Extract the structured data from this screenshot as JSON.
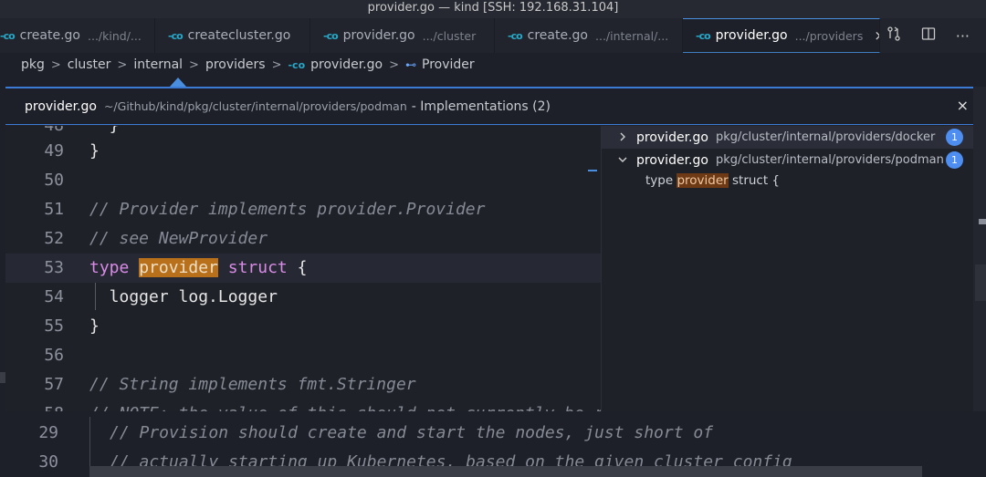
{
  "window": {
    "title": "provider.go — kind [SSH: 192.168.31.104]"
  },
  "tabs": [
    {
      "label": "create.go",
      "dir": ".../kind/..."
    },
    {
      "label": "createcluster.go",
      "dir": ""
    },
    {
      "label": "provider.go",
      "dir": ".../cluster"
    },
    {
      "label": "create.go",
      "dir": ".../internal/..."
    },
    {
      "label": "provider.go",
      "dir": ".../providers",
      "active": true
    }
  ],
  "tab_icon_text": "-co",
  "tab_actions": {
    "compare_icon": "git-compare-icon",
    "split_icon": "split-editor-icon",
    "more_label": "···"
  },
  "breadcrumb": {
    "items": [
      "pkg",
      "cluster",
      "internal",
      "providers",
      "provider.go",
      "Provider"
    ],
    "separator": ">",
    "struct_icon_text": "⊷"
  },
  "peek": {
    "file": "provider.go",
    "path": "~/Github/kind/pkg/cluster/internal/providers/podman",
    "title": "- Implementations (2)",
    "close": "×",
    "lines": [
      {
        "n": "48",
        "text": "  }"
      },
      {
        "n": "49",
        "text": "}"
      },
      {
        "n": "50",
        "text": ""
      },
      {
        "n": "51",
        "text": "// Provider implements provider.Provider"
      },
      {
        "n": "52",
        "text": "// see NewProvider"
      },
      {
        "n": "53",
        "kw1": "type",
        "hl": "provider",
        "kw2": "struct",
        "rest": " {"
      },
      {
        "n": "54",
        "text": "  logger log.Logger"
      },
      {
        "n": "55",
        "text": "}"
      },
      {
        "n": "56",
        "text": ""
      },
      {
        "n": "57",
        "text": "// String implements fmt.Stringer"
      },
      {
        "n": "58",
        "text": "// NOTE: the value of this should not currently be relied upon"
      }
    ],
    "results": [
      {
        "file": "provider.go",
        "dir": "pkg/cluster/internal/providers/docker",
        "count": "1",
        "expanded": false
      },
      {
        "file": "provider.go",
        "dir": "pkg/cluster/internal/providers/podman",
        "count": "1",
        "expanded": true
      }
    ],
    "preview": {
      "before": "type ",
      "match": "provider",
      "after": " struct {"
    }
  },
  "bottom_editor": {
    "lines": [
      {
        "n": "29",
        "text": "// Provision should create and start the nodes, just short of"
      },
      {
        "n": "30",
        "text": "// actually starting up Kubernetes, based on the given cluster config"
      }
    ]
  },
  "colors": {
    "accent": "#3d7ad6",
    "highlight": "#b8701a",
    "badge": "#4d8ef0",
    "keyword": "#d88ae6"
  }
}
